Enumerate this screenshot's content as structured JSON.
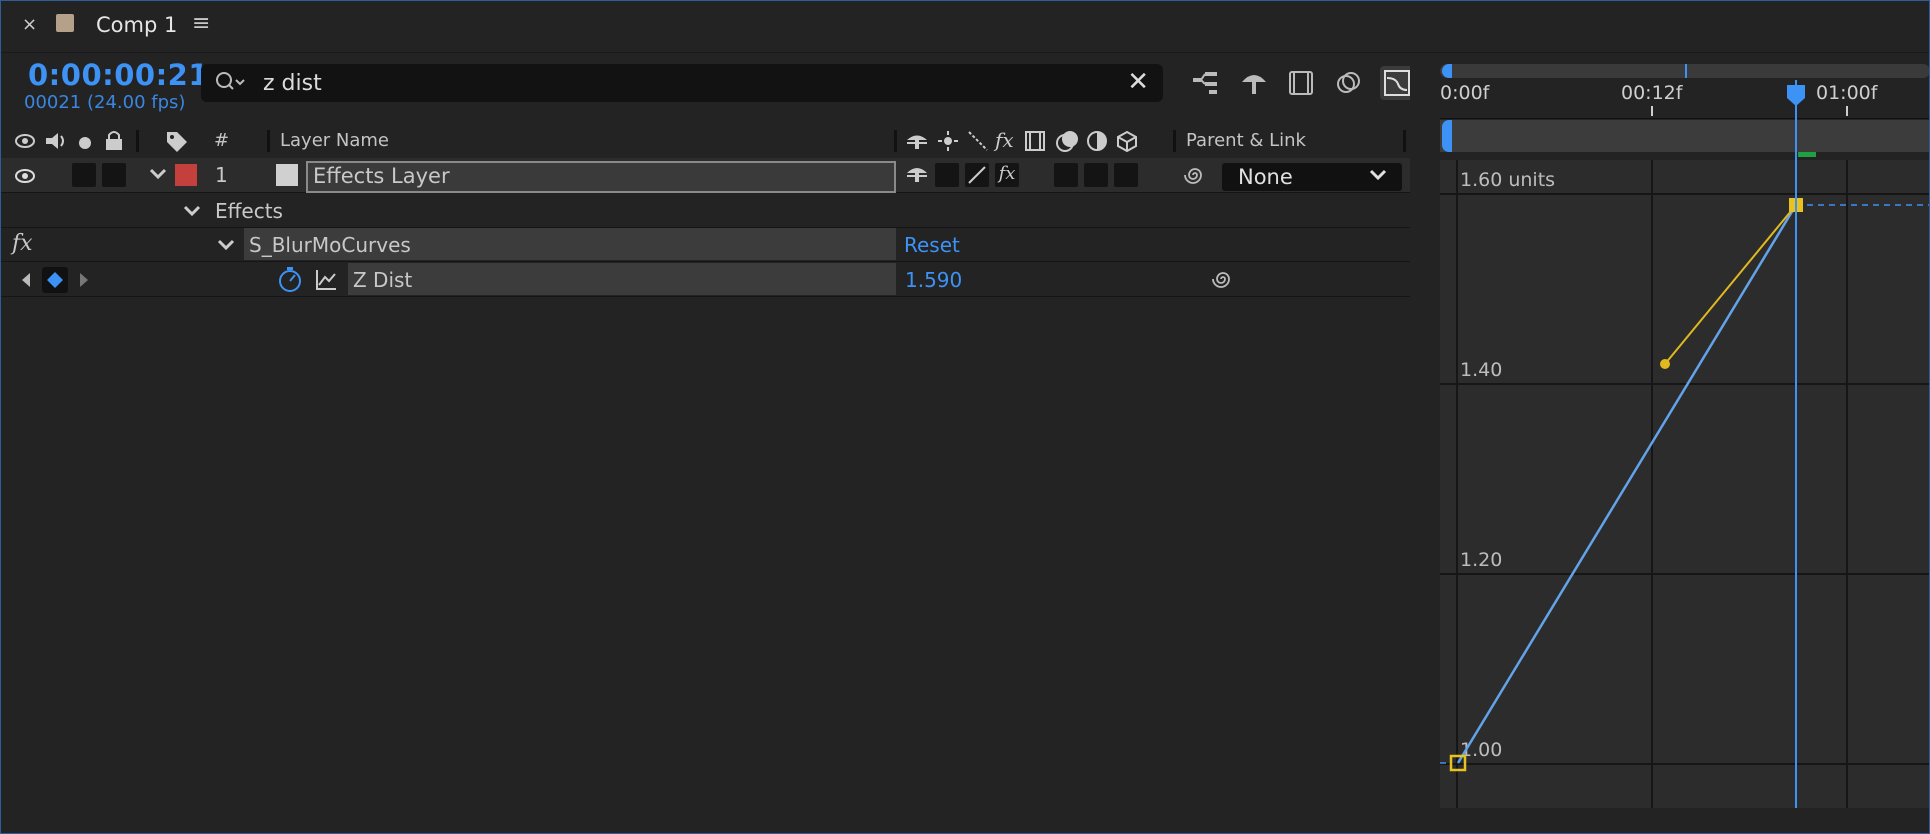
{
  "tab": {
    "close_icon": "×",
    "title": "Comp 1",
    "menu_icon": "≡"
  },
  "header": {
    "timecode": "0:00:00:21",
    "frame_info": "00021 (24.00 fps)",
    "search": {
      "value": "z dist",
      "clear_icon": "✕"
    }
  },
  "columns": {
    "number": "#",
    "layer_name": "Layer Name",
    "parent_link": "Parent & Link"
  },
  "layer": {
    "index": "1",
    "name": "Effects Layer",
    "label_color": "#c3403d",
    "parent_value": "None"
  },
  "effects_group": {
    "label": "Effects"
  },
  "effect": {
    "fx_label": "fx",
    "name": "S_BlurMoCurves",
    "reset_label": "Reset"
  },
  "property": {
    "name": "Z Dist",
    "value": "1.590"
  },
  "graph": {
    "ruler_labels": [
      "0:00f",
      "00:12f",
      "01:00f"
    ],
    "y_labels": [
      "1.60 units",
      "1.40",
      "1.20",
      "1.00"
    ],
    "accent": "#3d92f5",
    "keyframe_color": "#e8c21e",
    "curve_color": "#63a3ea",
    "handle_color": "#e0b820"
  }
}
